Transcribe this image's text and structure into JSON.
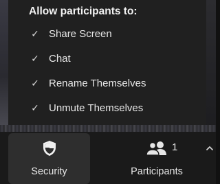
{
  "popup": {
    "title": "Allow participants to:",
    "items": [
      {
        "label": "Share Screen",
        "checked": true
      },
      {
        "label": "Chat",
        "checked": true
      },
      {
        "label": "Rename Themselves",
        "checked": true
      },
      {
        "label": "Unmute Themselves",
        "checked": true
      }
    ],
    "check_glyph": "✓"
  },
  "toolbar": {
    "security": {
      "label": "Security",
      "icon": "shield-icon"
    },
    "participants": {
      "label": "Participants",
      "icon": "people-icon",
      "count": "1"
    },
    "more_icon": "chevron-up-icon"
  },
  "colors": {
    "popup_bg": "#202020",
    "toolbar_bg": "#1a1a1a",
    "security_bg": "#2e2e2e",
    "text": "#e8e8e8"
  }
}
